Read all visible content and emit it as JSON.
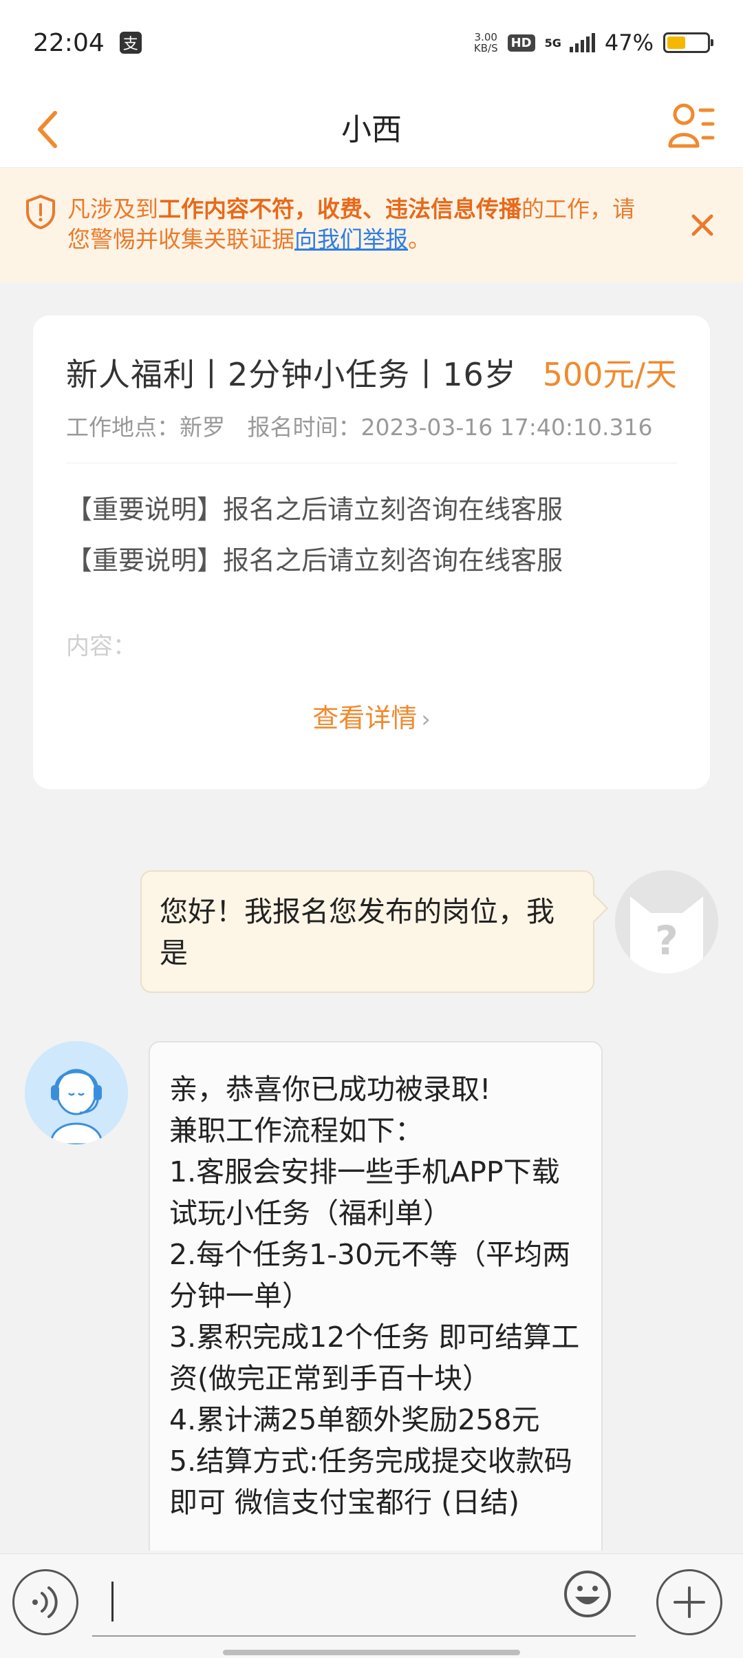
{
  "status_bar": {
    "time": "22:04",
    "pay_glyph": "支",
    "net_speed_value": "3.00",
    "net_speed_unit": "KB/S",
    "hd_badge": "HD",
    "network": "5G",
    "battery_percent": "47%",
    "battery_level": 0.47,
    "battery_color": "#f5b800"
  },
  "header": {
    "title": "小西",
    "accent_color": "#f08a2e",
    "icons": [
      "chevron-left-icon",
      "profile-list-icon"
    ]
  },
  "notice": {
    "part1": "凡涉及到",
    "bold1": "工作内容不符，收费、违法信息传播",
    "part2": "的工作，请您警惕并收集关联证据",
    "link": "向我们举报",
    "part3": "。",
    "icons": [
      "shield-warning-icon",
      "close-icon"
    ]
  },
  "job": {
    "title": "新人福利丨2分钟小任务丨16岁",
    "salary": "500元/天",
    "location_label": "工作地点：新罗",
    "signup_label": "报名时间：2023-03-16 17:40:10.316",
    "desc": [
      "【重要说明】报名之后请立刻咨询在线客服",
      "【重要说明】报名之后请立刻咨询在线客服"
    ],
    "content_label": "内容：",
    "more": "查看详情",
    "more_chevron": "›"
  },
  "messages": {
    "outgoing": "您好！我报名您发布的岗位，我是",
    "incoming": [
      "亲，恭喜你已成功被录取!",
      "兼职工作流程如下：",
      "1.客服会安排一些手机APP下载试玩小任务（福利单）",
      "2.每个任务1-30元不等（平均两分钟一单）",
      "3.累积完成12个任务 即可结算工资(做完正常到手百十块）",
      "4.累计满25单额外奖励258元",
      "5.结算方式:任务完成提交收款码即可 微信支付宝都行 (日结)"
    ]
  },
  "input_bar": {
    "placeholder": "",
    "icons": [
      "voice-icon",
      "emoji-icon",
      "plus-icon"
    ]
  }
}
